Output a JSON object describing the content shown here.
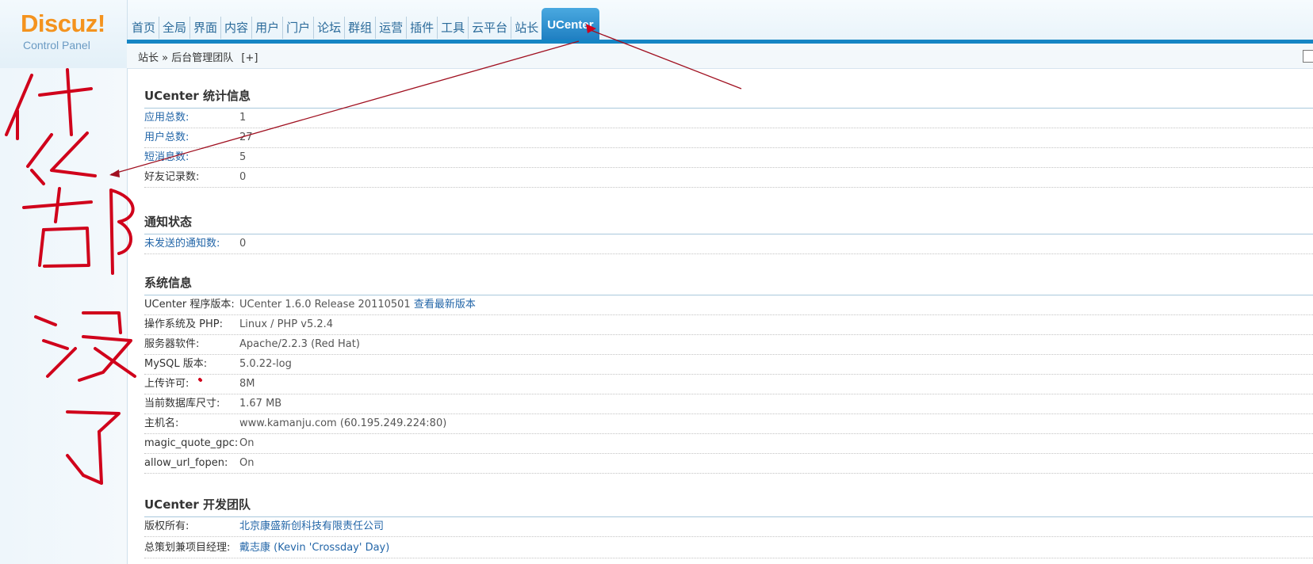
{
  "logo": {
    "main": "Discuz!",
    "sub": "Control Panel"
  },
  "nav": {
    "items": [
      "首页",
      "全局",
      "界面",
      "内容",
      "用户",
      "门户",
      "论坛",
      "群组",
      "运营",
      "插件",
      "工具",
      "云平台",
      "站长"
    ],
    "active": "UCenter"
  },
  "breadcrumb": {
    "parent": "站长",
    "sep": "»",
    "current": "后台管理团队",
    "add": "[+]"
  },
  "sections": {
    "stats": {
      "title": "UCenter 统计信息",
      "rows": [
        {
          "label": "应用总数:",
          "value": "1"
        },
        {
          "label": "用户总数:",
          "value": "27"
        },
        {
          "label": "短消息数:",
          "value": "5"
        },
        {
          "label": "好友记录数:",
          "value": "0"
        }
      ]
    },
    "notice": {
      "title": "通知状态",
      "rows": [
        {
          "label": "未发送的通知数:",
          "value": "0"
        }
      ]
    },
    "system": {
      "title": "系统信息",
      "version_label": "UCenter 程序版本:",
      "version_value": "UCenter 1.6.0 Release 20110501",
      "version_link": "查看最新版本",
      "rows": [
        {
          "label": "操作系统及 PHP:",
          "value": "Linux / PHP v5.2.4"
        },
        {
          "label": "服务器软件:",
          "value": "Apache/2.2.3 (Red Hat)"
        },
        {
          "label": "MySQL 版本:",
          "value": "5.0.22-log"
        },
        {
          "label": "上传许可:",
          "value": "8M"
        },
        {
          "label": "当前数据库尺寸:",
          "value": "1.67 MB"
        },
        {
          "label": "主机名:",
          "value": "www.kamanju.com (60.195.249.224:80)"
        },
        {
          "label": "magic_quote_gpc:",
          "value": "On"
        },
        {
          "label": "allow_url_fopen:",
          "value": "On"
        }
      ]
    },
    "team": {
      "title": "UCenter 开发团队",
      "rows": [
        {
          "label": "版权所有:",
          "value": "北京康盛新创科技有限责任公司"
        },
        {
          "label": "总策划兼项目经理:",
          "value": "戴志康 (Kevin 'Crossday' Day)"
        }
      ]
    }
  },
  "colors": {
    "accent": "#1585c4",
    "logo": "#f4931e",
    "annotation": "#d0021b"
  }
}
